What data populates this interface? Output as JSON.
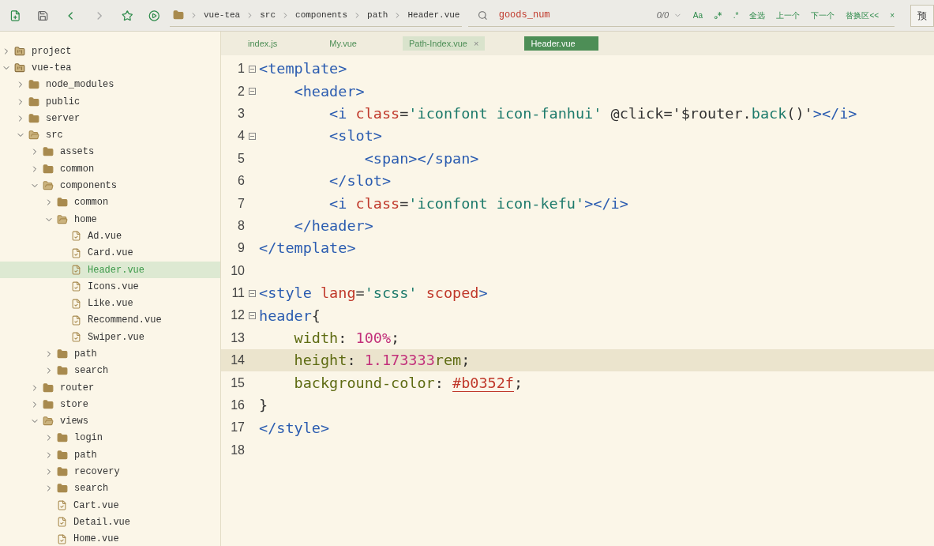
{
  "toolbar": {
    "breadcrumb": [
      "vue-tea",
      "src",
      "components",
      "path",
      "Header.vue"
    ],
    "search": {
      "value": "goods_num",
      "count": "0/0"
    },
    "find_buttons": [
      {
        "kind": "text",
        "label": "Aa"
      },
      {
        "kind": "icon"
      },
      {
        "kind": "text",
        "label": ".*"
      },
      {
        "kind": "text",
        "label": "全选"
      },
      {
        "kind": "text",
        "label": "上一个"
      },
      {
        "kind": "text",
        "label": "下一个"
      },
      {
        "kind": "text",
        "label": "替换区<<"
      },
      {
        "kind": "text",
        "label": "×"
      }
    ],
    "preview_button": "预"
  },
  "sidebar": {
    "items": [
      {
        "kind": "project",
        "name": "project",
        "expanded": false,
        "selected": false
      },
      {
        "kind": "project",
        "name": "vue-tea",
        "expanded": true,
        "selected": false,
        "children": [
          {
            "kind": "folder",
            "name": "node_modules",
            "expanded": false,
            "selected": false
          },
          {
            "kind": "folder",
            "name": "public",
            "expanded": false,
            "selected": false
          },
          {
            "kind": "folder",
            "name": "server",
            "expanded": false,
            "selected": false
          },
          {
            "kind": "folder",
            "name": "src",
            "expanded": true,
            "selected": false,
            "children": [
              {
                "kind": "folder",
                "name": "assets",
                "expanded": false,
                "selected": false
              },
              {
                "kind": "folder",
                "name": "common",
                "expanded": false,
                "selected": false
              },
              {
                "kind": "folder",
                "name": "components",
                "expanded": true,
                "selected": false,
                "children": [
                  {
                    "kind": "folder",
                    "name": "common",
                    "expanded": false,
                    "selected": false
                  },
                  {
                    "kind": "folder",
                    "name": "home",
                    "expanded": true,
                    "selected": false,
                    "children": [
                      {
                        "kind": "file",
                        "name": "Ad.vue",
                        "selected": false
                      },
                      {
                        "kind": "file",
                        "name": "Card.vue",
                        "selected": false
                      },
                      {
                        "kind": "file",
                        "name": "Header.vue",
                        "selected": true
                      },
                      {
                        "kind": "file",
                        "name": "Icons.vue",
                        "selected": false
                      },
                      {
                        "kind": "file",
                        "name": "Like.vue",
                        "selected": false
                      },
                      {
                        "kind": "file",
                        "name": "Recommend.vue",
                        "selected": false
                      },
                      {
                        "kind": "file",
                        "name": "Swiper.vue",
                        "selected": false
                      }
                    ]
                  },
                  {
                    "kind": "folder",
                    "name": "path",
                    "expanded": false,
                    "selected": false
                  },
                  {
                    "kind": "folder",
                    "name": "search",
                    "expanded": false,
                    "selected": false
                  }
                ]
              },
              {
                "kind": "folder",
                "name": "router",
                "expanded": false,
                "selected": false
              },
              {
                "kind": "folder",
                "name": "store",
                "expanded": false,
                "selected": false
              },
              {
                "kind": "folder",
                "name": "views",
                "expanded": true,
                "selected": false,
                "children": [
                  {
                    "kind": "folder",
                    "name": "login",
                    "expanded": false,
                    "selected": false
                  },
                  {
                    "kind": "folder",
                    "name": "path",
                    "expanded": false,
                    "selected": false
                  },
                  {
                    "kind": "folder",
                    "name": "recovery",
                    "expanded": false,
                    "selected": false
                  },
                  {
                    "kind": "folder",
                    "name": "search",
                    "expanded": false,
                    "selected": false
                  },
                  {
                    "kind": "file",
                    "name": "Cart.vue",
                    "selected": false
                  },
                  {
                    "kind": "file",
                    "name": "Detail.vue",
                    "selected": false
                  },
                  {
                    "kind": "file",
                    "name": "Home.vue",
                    "selected": false
                  }
                ]
              }
            ]
          }
        ]
      }
    ]
  },
  "tabs": [
    {
      "label": "index.js",
      "selected": false,
      "hovered": false
    },
    {
      "label": "My.vue",
      "selected": false,
      "hovered": false
    },
    {
      "label": "Path-Index.vue",
      "selected": false,
      "hovered": true,
      "close": "×"
    },
    {
      "label": "Header.vue",
      "selected": true,
      "hovered": false
    }
  ],
  "editor": {
    "lines": [
      {
        "number": "1",
        "foldable": true,
        "current": false,
        "tokens": [
          {
            "kind": "tag",
            "text": "<template>"
          }
        ]
      },
      {
        "number": "2",
        "foldable": true,
        "current": false,
        "tokens": [
          {
            "kind": "tag",
            "text": "    <header>"
          }
        ]
      },
      {
        "number": "3",
        "foldable": false,
        "current": false,
        "tokens": [
          {
            "kind": "tag",
            "text": "        <i"
          },
          {
            "kind": "attr",
            "text": " class"
          },
          {
            "kind": "punct",
            "text": "="
          },
          {
            "kind": "string",
            "text": "'iconfont icon-fanhui'"
          },
          {
            "kind": "plain",
            "text": " @click"
          },
          {
            "kind": "punct",
            "text": "="
          },
          {
            "kind": "plain",
            "text": "'$router."
          },
          {
            "kind": "string",
            "text": "back"
          },
          {
            "kind": "plain",
            "text": "()'"
          },
          {
            "kind": "tag",
            "text": "></i>"
          }
        ]
      },
      {
        "number": "4",
        "foldable": true,
        "current": false,
        "tokens": [
          {
            "kind": "tag",
            "text": "        <slot>"
          }
        ]
      },
      {
        "number": "5",
        "foldable": false,
        "current": false,
        "tokens": [
          {
            "kind": "tag",
            "text": "            <span></span>"
          }
        ]
      },
      {
        "number": "6",
        "foldable": false,
        "current": false,
        "tokens": [
          {
            "kind": "tag",
            "text": "        </slot>"
          }
        ]
      },
      {
        "number": "7",
        "foldable": false,
        "current": false,
        "tokens": [
          {
            "kind": "tag",
            "text": "        <i"
          },
          {
            "kind": "attr",
            "text": " class"
          },
          {
            "kind": "punct",
            "text": "="
          },
          {
            "kind": "string",
            "text": "'iconfont icon-kefu'"
          },
          {
            "kind": "tag",
            "text": "></i>"
          }
        ]
      },
      {
        "number": "8",
        "foldable": false,
        "current": false,
        "tokens": [
          {
            "kind": "tag",
            "text": "    </header>"
          }
        ]
      },
      {
        "number": "9",
        "foldable": false,
        "current": false,
        "tokens": [
          {
            "kind": "tag",
            "text": "</template>"
          }
        ]
      },
      {
        "number": "10",
        "foldable": false,
        "current": false
      },
      {
        "number": "11",
        "foldable": true,
        "current": false,
        "tokens": [
          {
            "kind": "tag",
            "text": "<style"
          },
          {
            "kind": "attr",
            "text": " lang"
          },
          {
            "kind": "punct",
            "text": "="
          },
          {
            "kind": "string",
            "text": "'scss'"
          },
          {
            "kind": "attr",
            "text": " scoped"
          },
          {
            "kind": "tag",
            "text": ">"
          }
        ]
      },
      {
        "number": "12",
        "foldable": true,
        "current": false,
        "tokens": [
          {
            "kind": "tag",
            "text": "header"
          },
          {
            "kind": "punct",
            "text": "{"
          }
        ]
      },
      {
        "number": "13",
        "foldable": false,
        "current": false,
        "tokens": [
          {
            "kind": "prop",
            "text": "    width"
          },
          {
            "kind": "punct",
            "text": ": "
          },
          {
            "kind": "number",
            "text": "100%"
          },
          {
            "kind": "punct",
            "text": ";"
          }
        ]
      },
      {
        "number": "14",
        "foldable": false,
        "current": true,
        "tokens": [
          {
            "kind": "prop",
            "text": "    height"
          },
          {
            "kind": "punct",
            "text": ": "
          },
          {
            "kind": "number",
            "text": "1.173333"
          },
          {
            "kind": "prop",
            "text": "rem"
          },
          {
            "kind": "punct",
            "text": ";"
          }
        ]
      },
      {
        "number": "15",
        "foldable": false,
        "current": false,
        "tokens": [
          {
            "kind": "prop",
            "text": "    background-color"
          },
          {
            "kind": "punct",
            "text": ": "
          },
          {
            "kind": "color",
            "text": "#b0352f"
          },
          {
            "kind": "punct",
            "text": ";"
          }
        ]
      },
      {
        "number": "16",
        "foldable": false,
        "current": false,
        "tokens": [
          {
            "kind": "punct",
            "text": "}"
          }
        ]
      },
      {
        "number": "17",
        "foldable": false,
        "current": false,
        "tokens": [
          {
            "kind": "tag",
            "text": "</style>"
          }
        ]
      },
      {
        "number": "18",
        "foldable": false,
        "current": false
      }
    ]
  }
}
